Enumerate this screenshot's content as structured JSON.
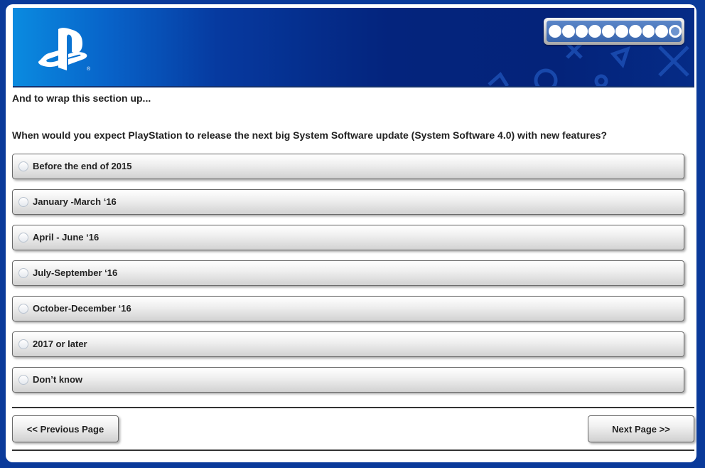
{
  "header": {
    "logo_name": "playstation-logo",
    "progress": {
      "total": 10,
      "completed": 9
    }
  },
  "intro_text": "And to wrap this section up...",
  "question": "When would you expect PlayStation to release the next big System Software update (System Software 4.0) with new features?",
  "options": [
    {
      "label": "Before the end of 2015"
    },
    {
      "label": "January -March ‘16"
    },
    {
      "label": "April - June ‘16"
    },
    {
      "label": "July-September ‘16"
    },
    {
      "label": "October-December ‘16"
    },
    {
      "label": "2017 or later"
    },
    {
      "label": "Don’t know"
    }
  ],
  "nav": {
    "previous_label": "<< Previous Page",
    "next_label": "Next Page >>"
  },
  "colors": {
    "page_background": "#0a3a9a",
    "banner_dark": "#04237a",
    "banner_light": "#0a8be0"
  }
}
